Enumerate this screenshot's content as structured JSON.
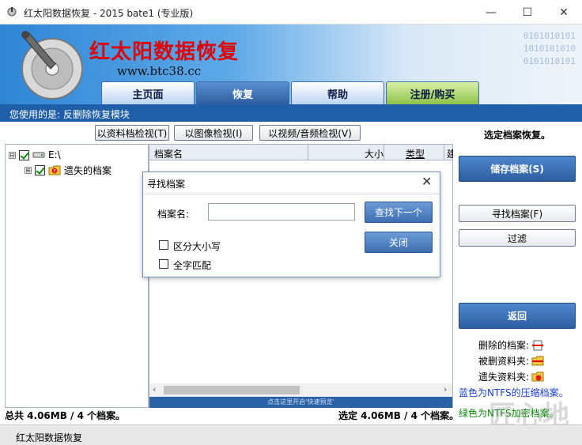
{
  "window": {
    "title": "红太阳数据恢复 - 2015 bate1 (专业版)",
    "minimize": "—",
    "maximize": "☐",
    "close": "✕"
  },
  "banner": {
    "brand": "红太阳数据恢复",
    "site": "www.btc38.cc",
    "binary_row1": "0101010101",
    "binary_row2": "1010101010",
    "binary_row3": "0101010101"
  },
  "tabs": [
    {
      "label": "主页面",
      "style": "blue"
    },
    {
      "label": "恢复",
      "style": "active"
    },
    {
      "label": "帮助",
      "style": "blue"
    },
    {
      "label": "注册/购买",
      "style": "green"
    }
  ],
  "info_strip": "您使用的是: 反删除恢复模块",
  "view_buttons": [
    "以资料档检视(T)",
    "以图像检视(I)",
    "以视频/音频检视(V)"
  ],
  "tree": {
    "root": {
      "expander": "⊟",
      "label": "E:\\"
    },
    "child": {
      "expander": "⊞",
      "label": "遗失的档案"
    }
  },
  "filelist": {
    "columns": [
      "档案名",
      "大小",
      "类型",
      "建"
    ],
    "preview_bar": "点击这里开启'快速预览'"
  },
  "right_panel": {
    "heading": "选定档案恢复。",
    "save_button": "储存档案(S)",
    "find_button": "寻找档案(F)",
    "filter_button": "过滤",
    "back_button": "返回",
    "legend": [
      {
        "label": "删除的档案:",
        "icon": "deleted-file-icon"
      },
      {
        "label": "被删资料夹:",
        "icon": "deleted-folder-icon"
      },
      {
        "label": "遗失资料夹:",
        "icon": "lost-folder-icon"
      }
    ],
    "ntfs_compressed": "蓝色为NTFS的压缩档案。",
    "ntfs_encrypted": "绿色为NTFS加密档案。",
    "colors": {
      "compressed": "#1a3fd6",
      "encrypted": "#0a8a0a"
    }
  },
  "dialog": {
    "title": "寻找档案",
    "close": "✕",
    "name_label": "档案名:",
    "name_value": "",
    "find_next": "查找下一个",
    "close_button": "关闭",
    "case_label": "区分大小写",
    "whole_label": "全字匹配"
  },
  "totals": "总共 4.06MB / 4 个档案。",
  "selected_totals": "选定 4.06MB / 4 个档案。",
  "statusbar": "红太阳数据恢复",
  "watermark": "匠心地"
}
